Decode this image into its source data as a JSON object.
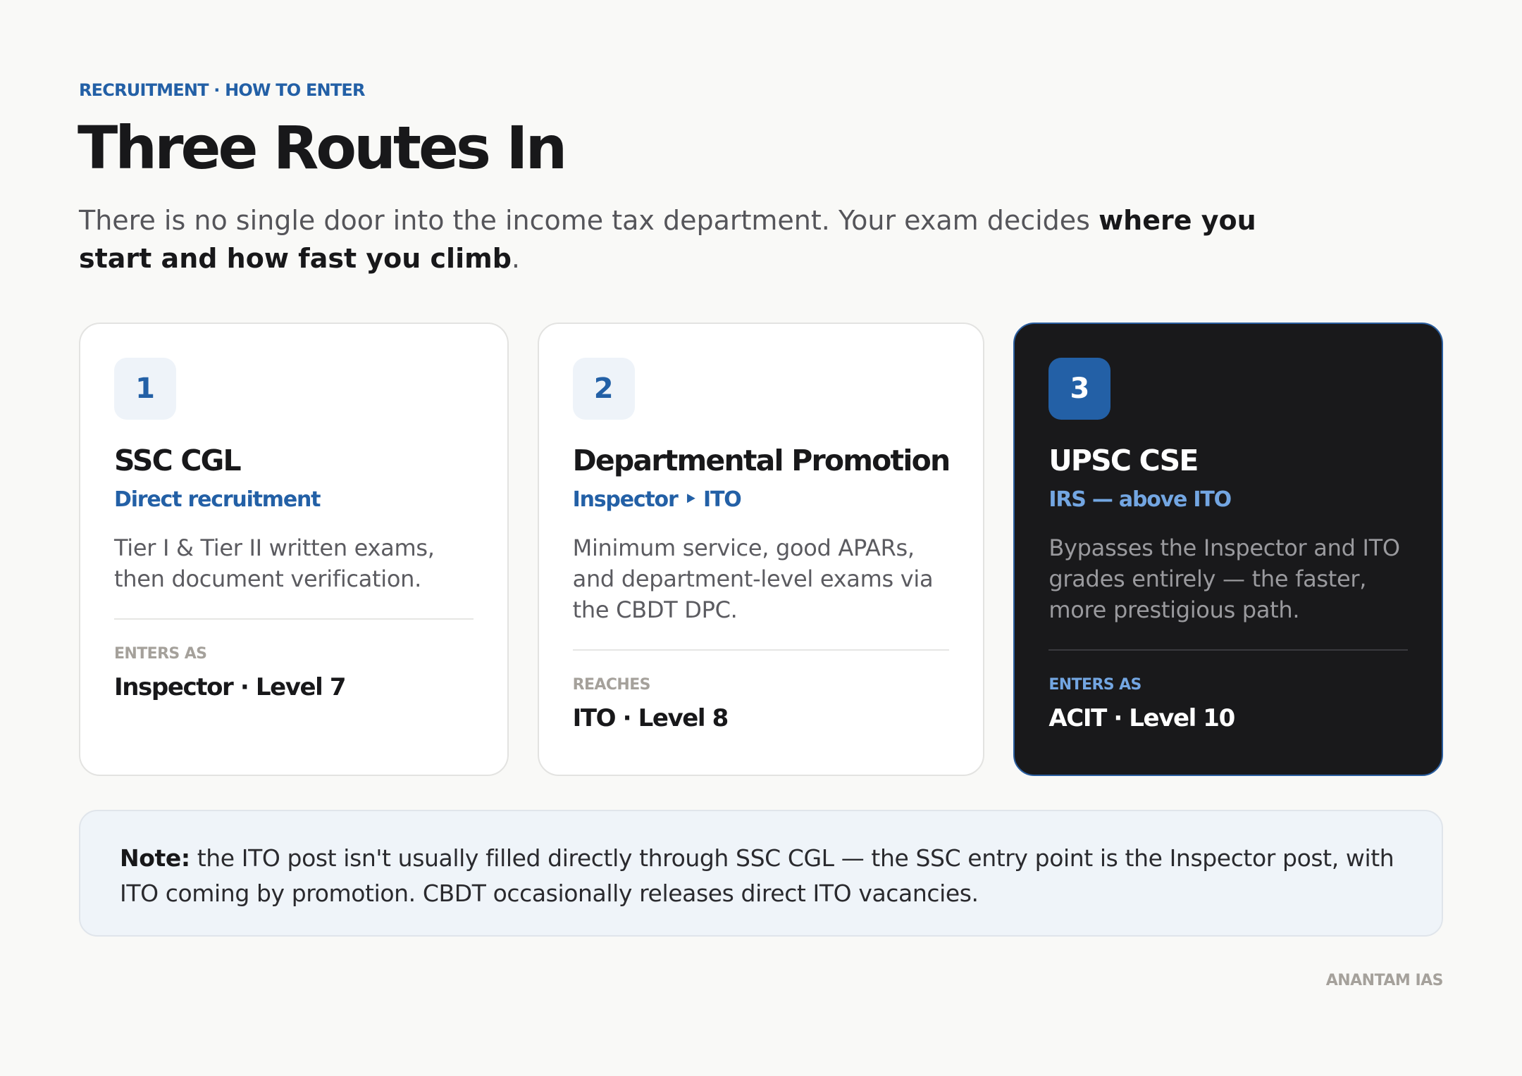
{
  "header": {
    "eyebrow": "RECRUITMENT · HOW TO ENTER",
    "title": "Three Routes In",
    "intro_plain": "There is no single door into the income tax department. Your exam decides ",
    "intro_bold": "where you start and how fast you climb",
    "intro_end": "."
  },
  "routes": [
    {
      "number": "1",
      "title": "SSC CGL",
      "subtitle": "Direct recruitment",
      "description": "Tier I & Tier II written exams, then document verification.",
      "meta_label": "ENTERS AS",
      "meta_value": "Inspector · Level 7"
    },
    {
      "number": "2",
      "title": "Departmental Promotion",
      "subtitle": "Inspector ‣ ITO",
      "description": "Minimum service, good APARs, and department-level exams via the CBDT DPC.",
      "meta_label": "REACHES",
      "meta_value": "ITO · Level 8"
    },
    {
      "number": "3",
      "title": "UPSC CSE",
      "subtitle": "IRS — above ITO",
      "description": "Bypasses the Inspector and ITO grades entirely — the faster, more prestigious path.",
      "meta_label": "ENTERS AS",
      "meta_value": "ACIT · Level 10"
    }
  ],
  "note": {
    "label": "Note:",
    "text": " the ITO post isn't usually filled directly through SSC CGL — the SSC entry point is the Inspector post, with ITO coming by promotion. CBDT occasionally releases direct ITO vacancies."
  },
  "footer": {
    "brand": "ANANTAM IAS"
  },
  "colors": {
    "accent": "#2360a6",
    "background": "#f9f9f7",
    "dark_card": "#19191b",
    "note_background": "#eff4f9"
  }
}
